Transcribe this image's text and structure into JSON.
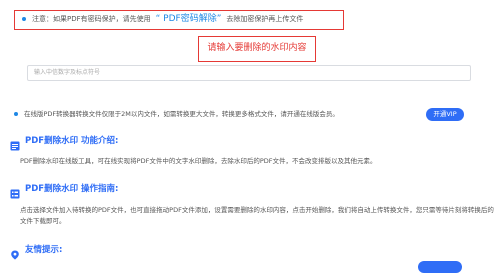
{
  "notice": {
    "prefix": "注意：如果PDF有密码保护，请先使用",
    "link": "“ PDF密码解除”",
    "suffix": "去除加密保护再上传文件"
  },
  "watermark_hint": "请输入要删除的水印内容",
  "watermark_input": {
    "placeholder": "输入中信数字及标点符号"
  },
  "vip": {
    "text": "在线版PDF转换器转换文件仅限于2M以内文件，如需转换更大文件，转换更多格式文件，请开通在线版会员。",
    "button": "开通VIP"
  },
  "sections": {
    "intro": {
      "title": "PDF删除水印 功能介绍:",
      "body": "PDF删除水印在线版工具，可在线实现将PDF文件中的文字水印删除，去除水印后的PDF文件，不会改变排版以及其他元素。"
    },
    "guide": {
      "title": "PDF删除水印 操作指南:",
      "body": "点击选择文件加入待转换的PDF文件，也可直接拖动PDF文件添加，设置需要删除的水印内容，点击开始删除，我们将自动上传转换文件，您只需等待片刻将转换后的文件下载即可。"
    },
    "tips": {
      "title": "友情提示:"
    }
  },
  "colors": {
    "accent": "#2f6df6",
    "highlight": "#e53935",
    "link": "#1e88e5"
  }
}
